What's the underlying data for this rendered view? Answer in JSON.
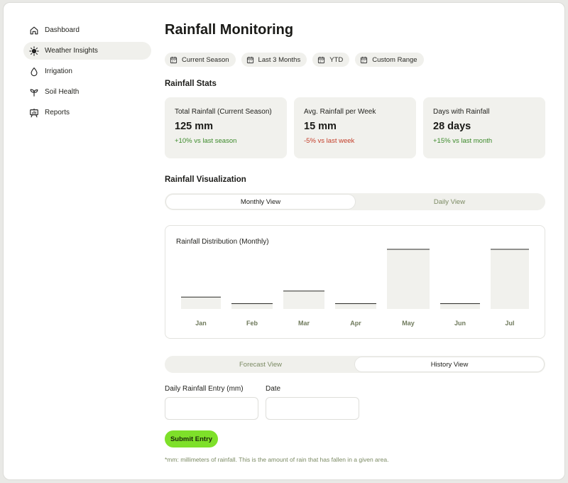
{
  "sidebar": {
    "items": [
      {
        "label": "Dashboard",
        "icon": "home-icon",
        "active": false
      },
      {
        "label": "Weather Insights",
        "icon": "sun-icon",
        "active": true
      },
      {
        "label": "Irrigation",
        "icon": "droplet-icon",
        "active": false
      },
      {
        "label": "Soil Health",
        "icon": "sprout-icon",
        "active": false
      },
      {
        "label": "Reports",
        "icon": "presentation-chart-icon",
        "active": false
      }
    ]
  },
  "header": {
    "title": "Rainfall Monitoring"
  },
  "filters": [
    {
      "label": "Current Season",
      "icon": "calendar-icon"
    },
    {
      "label": "Last 3 Months",
      "icon": "calendar-icon"
    },
    {
      "label": "YTD",
      "icon": "calendar-icon"
    },
    {
      "label": "Custom Range",
      "icon": "calendar-icon"
    }
  ],
  "stats": {
    "title": "Rainfall Stats",
    "cards": [
      {
        "label": "Total Rainfall (Current Season)",
        "value": "125 mm",
        "delta": "+10% vs last season",
        "trend": "positive"
      },
      {
        "label": "Avg. Rainfall per Week",
        "value": "15 mm",
        "delta": "-5% vs last week",
        "trend": "negative"
      },
      {
        "label": "Days with Rainfall",
        "value": "28 days",
        "delta": "+15% vs last month",
        "trend": "positive"
      }
    ]
  },
  "visualization": {
    "title": "Rainfall Visualization",
    "view_toggle": {
      "options": [
        "Monthly View",
        "Daily View"
      ],
      "selected": "Monthly View"
    }
  },
  "chart_data": {
    "type": "bar",
    "title": "Rainfall Distribution (Monthly)",
    "categories": [
      "Jan",
      "Feb",
      "Mar",
      "Apr",
      "May",
      "Jun",
      "Jul"
    ],
    "values": [
      20,
      9,
      30,
      9,
      100,
      9,
      100
    ],
    "ylim": [
      0,
      100
    ],
    "grid": false,
    "bar_color": "#f1f1ed",
    "bar_top_color": "#2a2a26"
  },
  "history": {
    "toggle": {
      "options": [
        "Forecast View",
        "History View"
      ],
      "selected": "History View"
    },
    "entry_label": "Daily Rainfall Entry (mm)",
    "entry_value": "",
    "date_label": "Date",
    "date_value": "",
    "submit_label": "Submit Entry",
    "footnote": "*mm: millimeters of rainfall. This is the amount of rain that has fallen in a given area."
  },
  "colors": {
    "accent": "#7ee02a",
    "positive": "#3c8a2b",
    "negative": "#c43e2a",
    "muted_text": "#7b8a63",
    "card_bg": "#f1f1ed"
  }
}
